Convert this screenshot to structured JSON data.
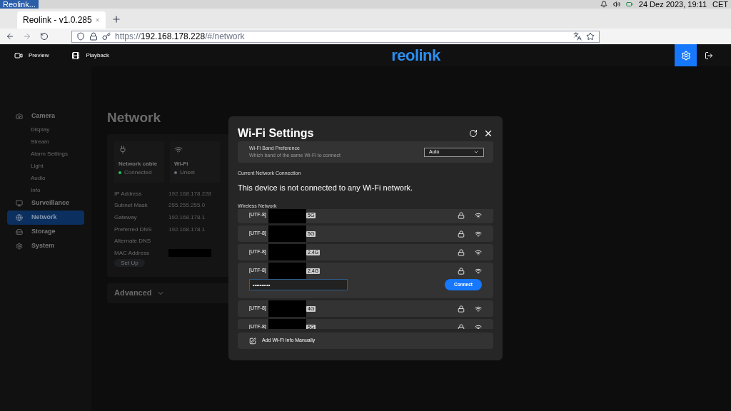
{
  "taskbar": {
    "window_title": "Reolink...",
    "date_time": "24 Dez 2023, 19:11",
    "timezone": "CET"
  },
  "browser": {
    "tab_title": "Reolink - v1.0.285",
    "url_prefix": "https://",
    "url_host": "192.168.178.228",
    "url_path": "/#/network"
  },
  "header": {
    "nav": [
      {
        "label": "Preview",
        "kind": "video"
      },
      {
        "label": "Playback",
        "kind": "film"
      }
    ],
    "logo": "reolink"
  },
  "sidebar": [
    {
      "label": "Camera",
      "kind": "camera",
      "selected": false,
      "children": [
        {
          "label": "Display"
        },
        {
          "label": "Stream"
        },
        {
          "label": "Alarm Settings"
        },
        {
          "label": "Light"
        },
        {
          "label": "Audio"
        },
        {
          "label": "Info"
        }
      ]
    },
    {
      "label": "Surveillance",
      "kind": "monitor",
      "selected": false
    },
    {
      "label": "Network",
      "kind": "globe",
      "selected": true
    },
    {
      "label": "Storage",
      "kind": "storage",
      "selected": false
    },
    {
      "label": "System",
      "kind": "gear",
      "selected": false
    }
  ],
  "page": {
    "title": "Network",
    "cards": [
      {
        "title": "Network cable",
        "status": "Connected",
        "color": "#22c55e",
        "kind": "cable"
      },
      {
        "title": "Wi-Fi",
        "status": "Unset",
        "color": "#6b7280",
        "kind": "wifi"
      }
    ],
    "fields": [
      {
        "label": "IP Address",
        "value": "192.168.178.228"
      },
      {
        "label": "Subnet Mask",
        "value": "255.255.255.0"
      },
      {
        "label": "Gateway",
        "value": "192.168.178.1"
      },
      {
        "label": "Preferred DNS",
        "value": "192.168.178.1"
      },
      {
        "label": "Alternate DNS"
      },
      {
        "label": "MAC Address",
        "redacted": true
      }
    ],
    "setup_button": "Set Up",
    "advanced": "Advanced"
  },
  "dialog": {
    "title": "Wi-Fi Settings",
    "band": {
      "label": "Wi-Fi Band Preference",
      "hint": "Which band of the same Wi-Fi to connect",
      "value": "Auto"
    },
    "current_label": "Current Network Connection",
    "current_text": "This device is not connected to any Wi-Fi network.",
    "list_label": "Wireless Network",
    "networks": [
      {
        "name": "[UTF-8]",
        "band": "5G",
        "expanded": false
      },
      {
        "name": "[UTF-8]",
        "band": "5G",
        "expanded": false
      },
      {
        "name": "[UTF-8]",
        "band": "2.4G",
        "expanded": false
      },
      {
        "name": "[UTF-8]",
        "band": "2.4G",
        "expanded": true,
        "password": "••••••••••"
      },
      {
        "name": "[UTF-8]",
        "band": "4G",
        "expanded": false
      },
      {
        "name": "[UTF-8]",
        "band": "5G",
        "expanded": false
      }
    ],
    "connect": "Connect",
    "add_manual": "Add Wi-Fi Info Manually"
  }
}
